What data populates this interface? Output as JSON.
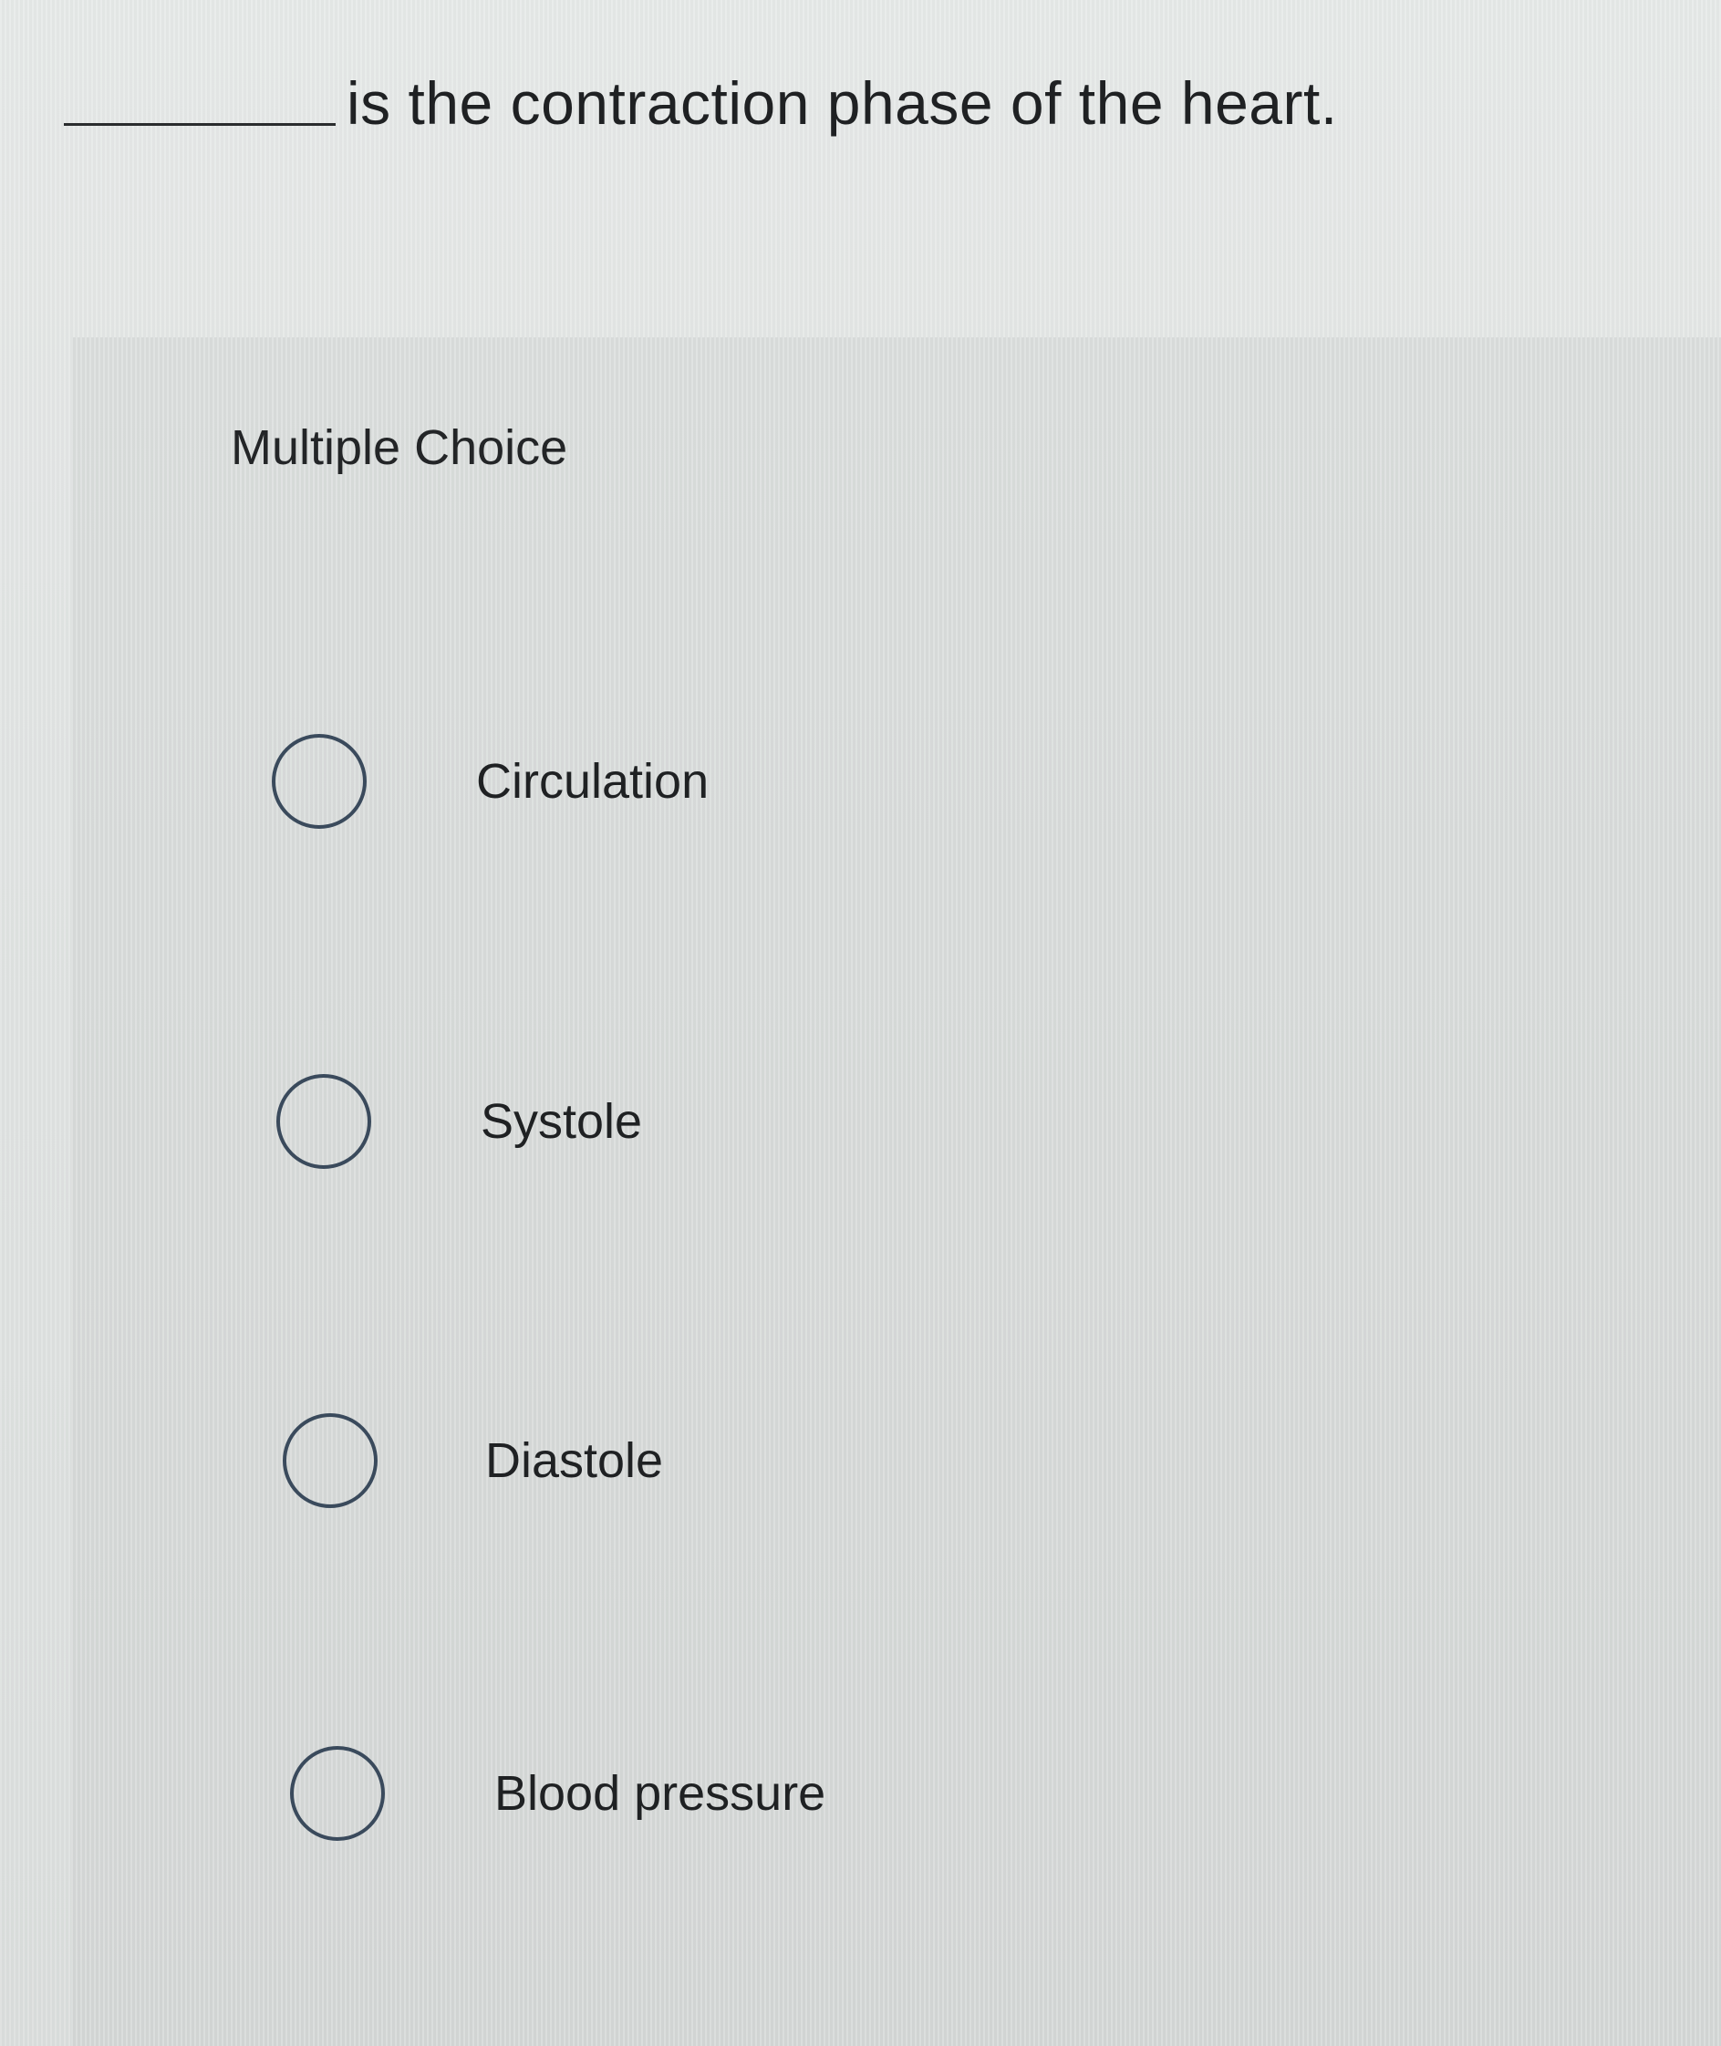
{
  "question": {
    "text": "is the contraction phase of the heart."
  },
  "answer_panel": {
    "title": "Multiple Choice",
    "options": [
      {
        "label": "Circulation"
      },
      {
        "label": "Systole"
      },
      {
        "label": "Diastole"
      },
      {
        "label": "Blood pressure"
      }
    ]
  }
}
